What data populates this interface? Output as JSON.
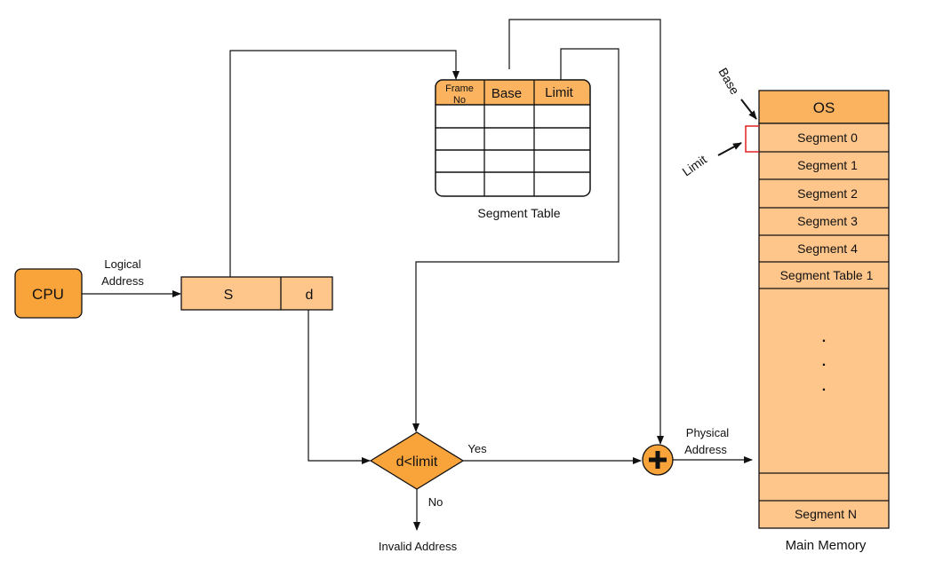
{
  "colors": {
    "dark_orange": "#F9A33B",
    "header_orange": "#FBB360",
    "light_orange": "#FFC68C",
    "limit_bracket": "#E02020"
  },
  "cpu": {
    "label": "CPU"
  },
  "logical_address": {
    "line1": "Logical",
    "line2": "Address"
  },
  "address_box": {
    "s": "S",
    "d": "d"
  },
  "segment_table": {
    "headers": [
      "Frame No",
      "Base",
      "Limit"
    ],
    "header_frame_line1": "Frame",
    "header_frame_line2": "No",
    "caption": "Segment Table"
  },
  "decision": {
    "label": "d<limit",
    "yes": "Yes",
    "no": "No",
    "invalid": "Invalid Address"
  },
  "adder": {
    "icon": "plus-icon"
  },
  "physical_address": {
    "line1": "Physical",
    "line2": "Address"
  },
  "memory": {
    "caption": "Main Memory",
    "blocks": [
      "OS",
      "Segment 0",
      "Segment 1",
      "Segment 2",
      "Segment 3",
      "Segment 4",
      "Segment Table 1",
      "",
      "",
      "Segment N"
    ],
    "dots": ".",
    "base_label": "Base",
    "limit_label": "Limit"
  }
}
